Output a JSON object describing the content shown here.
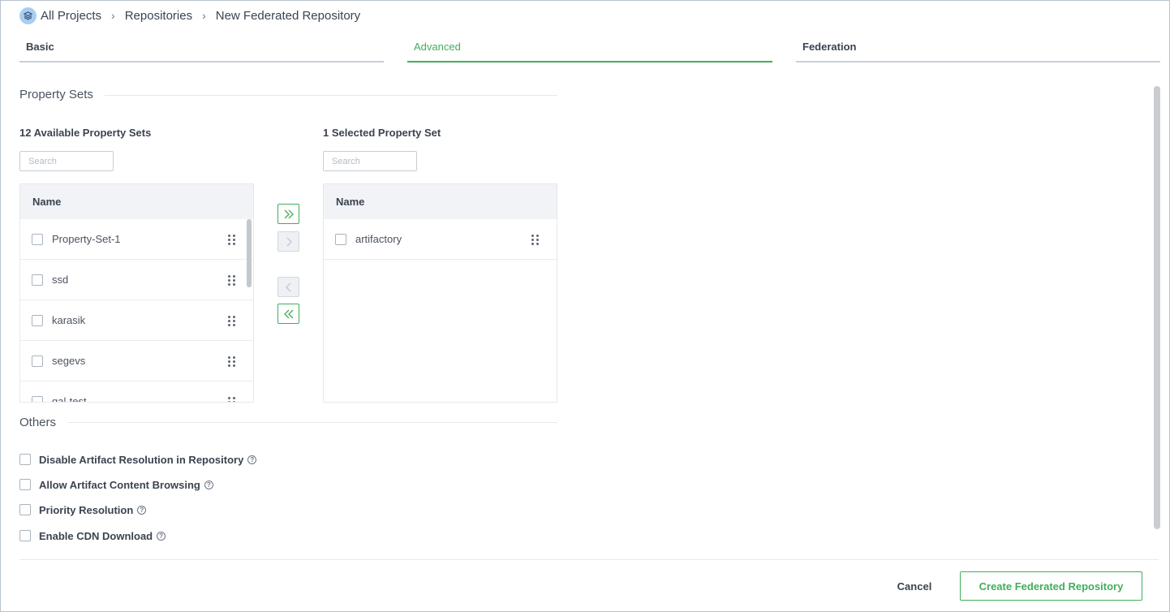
{
  "breadcrumb": {
    "items": [
      "All Projects",
      "Repositories",
      "New Federated Repository"
    ]
  },
  "tabs": [
    {
      "label": "Basic",
      "active": false
    },
    {
      "label": "Advanced",
      "active": true
    },
    {
      "label": "Federation",
      "active": false
    }
  ],
  "property_sets": {
    "section_title": "Property Sets",
    "available": {
      "title": "12 Available Property Sets",
      "search_placeholder": "Search",
      "column": "Name",
      "items": [
        "Property-Set-1",
        "ssd",
        "karasik",
        "segevs",
        "gal-test"
      ]
    },
    "selected": {
      "title": "1 Selected Property Set",
      "search_placeholder": "Search",
      "column": "Name",
      "items": [
        "artifactory"
      ]
    }
  },
  "others": {
    "section_title": "Others",
    "options": [
      {
        "label": "Disable Artifact Resolution in Repository",
        "checked": false
      },
      {
        "label": "Allow Artifact Content Browsing",
        "checked": false
      },
      {
        "label": "Priority Resolution",
        "checked": false
      },
      {
        "label": "Enable CDN Download",
        "checked": false
      }
    ]
  },
  "footer": {
    "cancel_label": "Cancel",
    "create_label": "Create Federated Repository"
  },
  "colors": {
    "accent": "#41ae5a",
    "tab_inactive": "#c9d0d8"
  },
  "icons": {
    "logo": "project-stack-icon",
    "separator": "chevron-right-icon",
    "drag": "drag-handle-icon",
    "help": "help-circle-icon"
  }
}
